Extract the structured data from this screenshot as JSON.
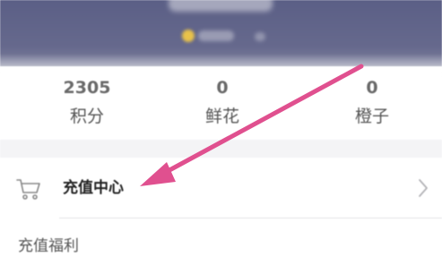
{
  "stats": [
    {
      "value": "2305",
      "label": "积分"
    },
    {
      "value": "0",
      "label": "鲜花"
    },
    {
      "value": "0",
      "label": "橙子"
    }
  ],
  "recharge_row": {
    "label": "充值中心",
    "icon": "shopping-cart-icon",
    "trailing_icon": "chevron-right-icon"
  },
  "section": {
    "label": "充值福利"
  },
  "annotation": {
    "type": "arrow",
    "color": "#e0508f",
    "points_to": "recharge_row"
  },
  "colors": {
    "header": "#62658a",
    "band": "#f4f4f6",
    "divider": "#e3e3e6"
  }
}
